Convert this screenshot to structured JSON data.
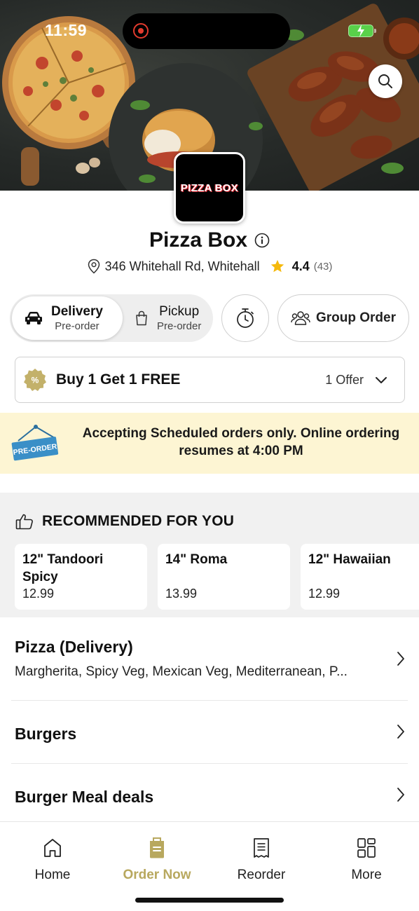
{
  "status_bar": {
    "time": "11:59"
  },
  "store": {
    "logo_text": "PIZZA BOX",
    "name": "Pizza Box",
    "address": "346 Whitehall Rd, Whitehall",
    "rating": "4.4",
    "rating_count": "(43)"
  },
  "modes": {
    "delivery": {
      "title": "Delivery",
      "subtitle": "Pre-order"
    },
    "pickup": {
      "title": "Pickup",
      "subtitle": "Pre-order"
    },
    "group_order": "Group Order"
  },
  "offer": {
    "title": "Buy 1 Get 1 FREE",
    "count": "1 Offer"
  },
  "banner": {
    "sign_text": "PRE-ORDER",
    "message": "Accepting Scheduled orders only. Online ordering resumes at 4:00 PM"
  },
  "recommended": {
    "header": "RECOMMENDED FOR YOU",
    "items": [
      {
        "name": "12\" Tandoori Spicy",
        "price": "12.99"
      },
      {
        "name": "14\" Roma",
        "price": "13.99"
      },
      {
        "name": "12\" Hawaiian",
        "price": "12.99"
      }
    ]
  },
  "categories": [
    {
      "title": "Pizza (Delivery)",
      "description": "Margherita, Spicy Veg, Mexican Veg, Mediterranean, P..."
    },
    {
      "title": "Burgers",
      "description": ""
    },
    {
      "title": "Burger Meal deals",
      "description": ""
    }
  ],
  "tabbar": {
    "items": [
      {
        "label": "Home",
        "icon": "home-icon"
      },
      {
        "label": "Order Now",
        "icon": "order-bag-icon"
      },
      {
        "label": "Reorder",
        "icon": "receipt-icon"
      },
      {
        "label": "More",
        "icon": "grid-icon"
      }
    ],
    "active_index": 1
  },
  "colors": {
    "accent": "#b8a85e",
    "banner_bg": "#fdf5d3",
    "rating_star": "#f5b90c",
    "section_bg": "#f1f1f1"
  }
}
